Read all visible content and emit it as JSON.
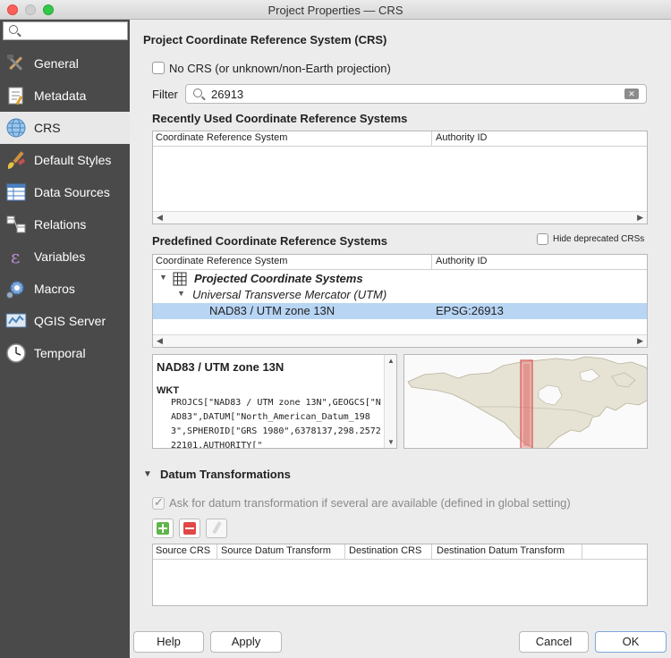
{
  "window": {
    "title": "Project Properties — CRS"
  },
  "sidebar": {
    "search": {
      "placeholder": "",
      "value": ""
    },
    "items": [
      {
        "label": "General",
        "icon": "hammer-wrench-icon",
        "active": false
      },
      {
        "label": "Metadata",
        "icon": "metadata-icon",
        "active": false
      },
      {
        "label": "CRS",
        "icon": "globe-icon",
        "active": true
      },
      {
        "label": "Default Styles",
        "icon": "paint-brush-icon",
        "active": false
      },
      {
        "label": "Data Sources",
        "icon": "table-icon",
        "active": false
      },
      {
        "label": "Relations",
        "icon": "relations-icon",
        "active": false
      },
      {
        "label": "Variables",
        "icon": "epsilon-icon",
        "active": false
      },
      {
        "label": "Macros",
        "icon": "gear-icon",
        "active": false
      },
      {
        "label": "QGIS Server",
        "icon": "server-icon",
        "active": false
      },
      {
        "label": "Temporal",
        "icon": "clock-icon",
        "active": false
      }
    ]
  },
  "crs_section": {
    "heading": "Project Coordinate Reference System (CRS)",
    "no_crs_label": "No CRS (or unknown/non-Earth projection)",
    "filter_label": "Filter",
    "filter_value": "26913"
  },
  "recent": {
    "heading": "Recently Used Coordinate Reference Systems",
    "columns": [
      "Coordinate Reference System",
      "Authority ID"
    ]
  },
  "predefined": {
    "heading": "Predefined Coordinate Reference Systems",
    "hide_deprecated_label": "Hide deprecated CRSs",
    "columns": [
      "Coordinate Reference System",
      "Authority ID"
    ],
    "rows": [
      {
        "label": "Projected Coordinate Systems",
        "authority": ""
      },
      {
        "label": "Universal Transverse Mercator (UTM)",
        "authority": ""
      },
      {
        "label": "NAD83 / UTM zone 13N",
        "authority": "EPSG:26913"
      }
    ]
  },
  "details": {
    "name": "NAD83 / UTM zone 13N",
    "wkt_label": "WKT",
    "wkt_text": "PROJCS[\"NAD83 / UTM zone 13N\",GEOGCS[\"NAD83\",DATUM[\"North_American_Datum_1983\",SPHEROID[\"GRS 1980\",6378137,298.257222101,AUTHORITY[\""
  },
  "datum": {
    "heading": "Datum Transformations",
    "ask_label": "Ask for datum transformation if several are available (defined in global setting)",
    "columns": [
      "Source CRS",
      "Source Datum Transform",
      "Destination CRS",
      "Destination Datum Transform"
    ]
  },
  "buttons": {
    "help": "Help",
    "apply": "Apply",
    "cancel": "Cancel",
    "ok": "OK"
  },
  "colors": {
    "sidebar_bg": "#4a4a4a",
    "selection": "#b8d5f4",
    "extent_red": "#e05555"
  }
}
